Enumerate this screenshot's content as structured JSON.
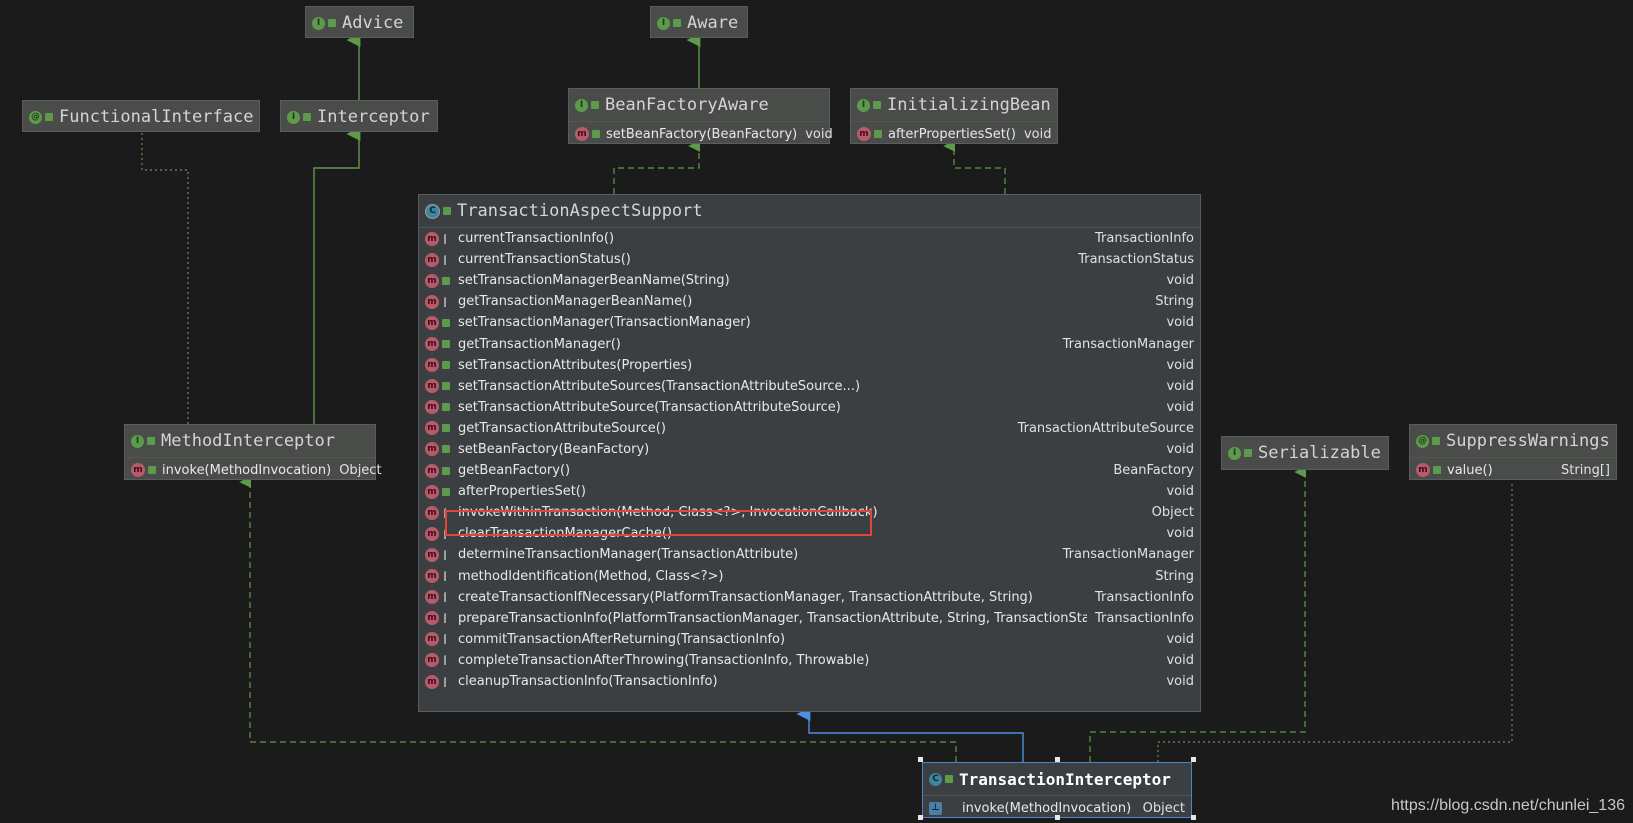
{
  "nodes": {
    "advice": {
      "name": "Advice"
    },
    "aware": {
      "name": "Aware"
    },
    "functionalInterface": {
      "name": "FunctionalInterface"
    },
    "interceptor": {
      "name": "Interceptor"
    },
    "beanFactoryAware": {
      "name": "BeanFactoryAware",
      "method": "setBeanFactory(BeanFactory)",
      "ret": "void"
    },
    "initializingBean": {
      "name": "InitializingBean",
      "method": "afterPropertiesSet()",
      "ret": "void"
    },
    "methodInterceptor": {
      "name": "MethodInterceptor",
      "method": "invoke(MethodInvocation)",
      "ret": "Object"
    },
    "serializable": {
      "name": "Serializable"
    },
    "suppressWarnings": {
      "name": "SuppressWarnings",
      "method": "value()",
      "ret": "String[]"
    },
    "transactionInterceptor": {
      "name": "TransactionInterceptor",
      "method": "invoke(MethodInvocation)",
      "ret": "Object"
    },
    "transactionAspectSupport": {
      "name": "TransactionAspectSupport",
      "methods": [
        {
          "sig": "currentTransactionInfo()",
          "ret": "TransactionInfo"
        },
        {
          "sig": "currentTransactionStatus()",
          "ret": "TransactionStatus"
        },
        {
          "sig": "setTransactionManagerBeanName(String)",
          "ret": "void"
        },
        {
          "sig": "getTransactionManagerBeanName()",
          "ret": "String"
        },
        {
          "sig": "setTransactionManager(TransactionManager)",
          "ret": "void"
        },
        {
          "sig": "getTransactionManager()",
          "ret": "TransactionManager"
        },
        {
          "sig": "setTransactionAttributes(Properties)",
          "ret": "void"
        },
        {
          "sig": "setTransactionAttributeSources(TransactionAttributeSource...)",
          "ret": "void"
        },
        {
          "sig": "setTransactionAttributeSource(TransactionAttributeSource)",
          "ret": "void"
        },
        {
          "sig": "getTransactionAttributeSource()",
          "ret": "TransactionAttributeSource"
        },
        {
          "sig": "setBeanFactory(BeanFactory)",
          "ret": "void"
        },
        {
          "sig": "getBeanFactory()",
          "ret": "BeanFactory"
        },
        {
          "sig": "afterPropertiesSet()",
          "ret": "void"
        },
        {
          "sig": "invokeWithinTransaction(Method, Class<?>, InvocationCallback)",
          "ret": "Object"
        },
        {
          "sig": "clearTransactionManagerCache()",
          "ret": "void"
        },
        {
          "sig": "determineTransactionManager(TransactionAttribute)",
          "ret": "TransactionManager"
        },
        {
          "sig": "methodIdentification(Method, Class<?>)",
          "ret": "String"
        },
        {
          "sig": "createTransactionIfNecessary(PlatformTransactionManager, TransactionAttribute, String)",
          "ret": "TransactionInfo"
        },
        {
          "sig": "prepareTransactionInfo(PlatformTransactionManager, TransactionAttribute, String, TransactionStatus)",
          "ret": "TransactionInfo"
        },
        {
          "sig": "commitTransactionAfterReturning(TransactionInfo)",
          "ret": "void"
        },
        {
          "sig": "completeTransactionAfterThrowing(TransactionInfo, Throwable)",
          "ret": "void"
        },
        {
          "sig": "cleanupTransactionInfo(TransactionInfo)",
          "ret": "void"
        }
      ]
    }
  },
  "watermark": "https://blog.csdn.net/chunlei_136",
  "colors": {
    "extends": "#5e9a4b",
    "implements": "#5e9a4b",
    "inherit": "#4d8fe0",
    "highlight": "#e0463a"
  }
}
